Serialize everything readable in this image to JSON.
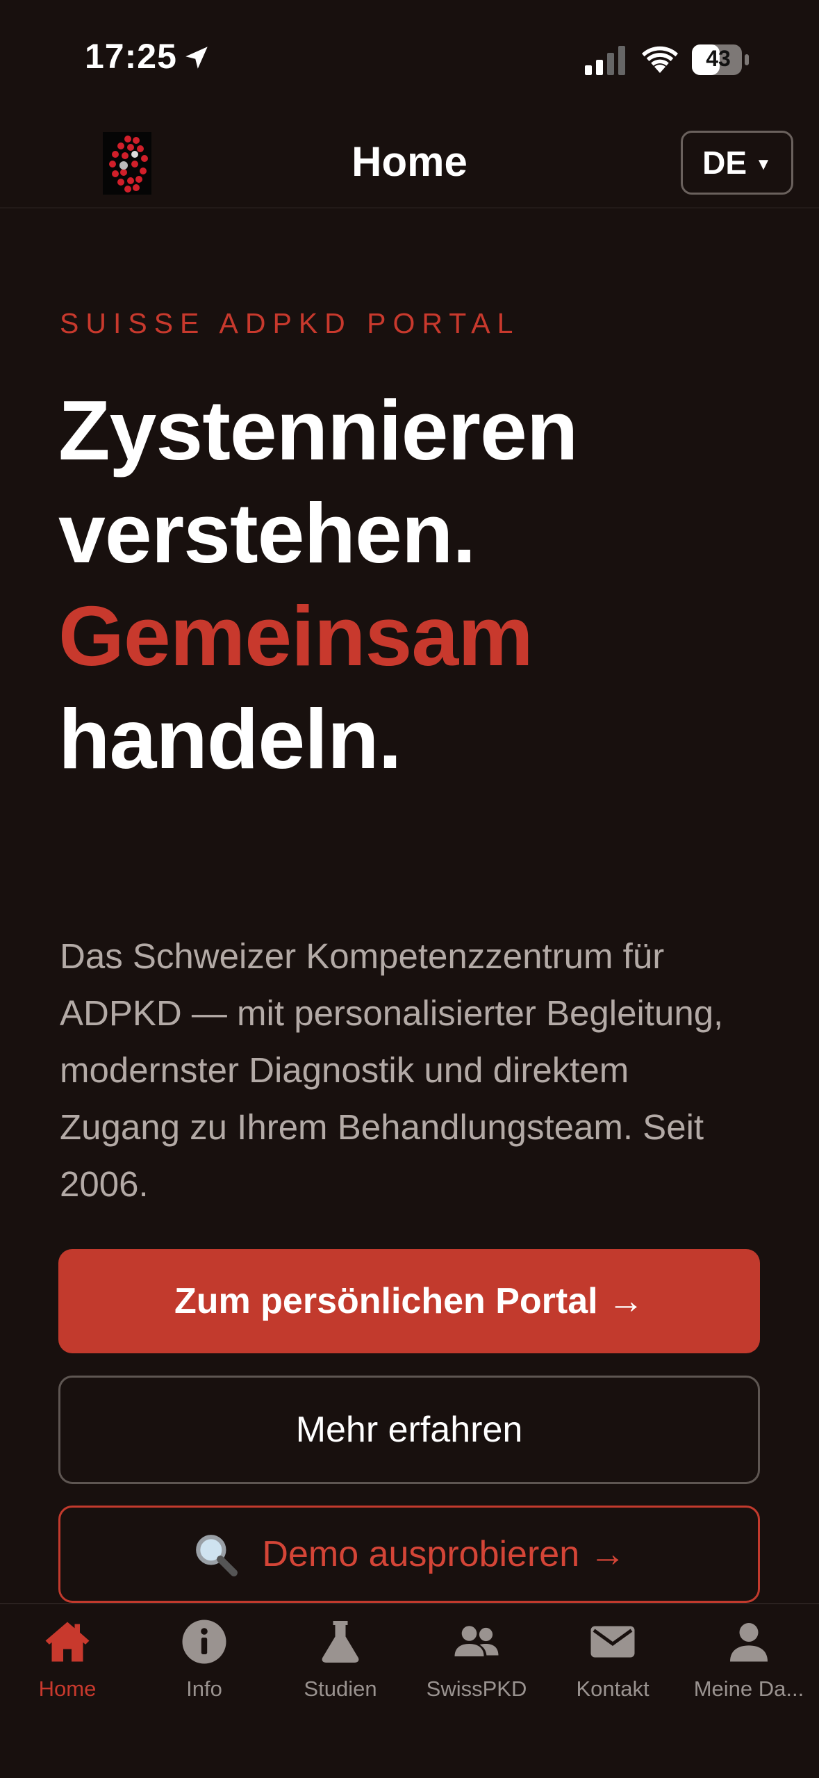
{
  "status_bar": {
    "time": "17:25",
    "battery": "43",
    "icons": [
      "location-arrow-icon",
      "signal-icon",
      "wifi-icon",
      "battery-icon"
    ]
  },
  "header": {
    "title": "Home",
    "language": "DE",
    "logo": "kidney-cells-logo"
  },
  "hero": {
    "eyebrow": "SUISSE ADPKD PORTAL",
    "line1": "Zystennieren",
    "line2": "verstehen.",
    "line3_accent": "Gemeinsam",
    "line4": "handeln.",
    "description": "Das Schweizer Kompetenzzentrum für ADPKD — mit personalisierter Begleitung, modernster Diagnostik und direktem Zugang zu Ihrem Behandlungsteam. Seit 2006."
  },
  "actions": {
    "primary": "Zum persönlichen Portal →",
    "secondary": "Mehr erfahren",
    "demo": "Demo ausprobieren →",
    "demo_icon": "magnifier-icon"
  },
  "tabs": [
    {
      "label": "Home",
      "icon": "home-icon",
      "active": true
    },
    {
      "label": "Info",
      "icon": "info-icon",
      "active": false
    },
    {
      "label": "Studien",
      "icon": "flask-icon",
      "active": false
    },
    {
      "label": "SwissPKD",
      "icon": "people-icon",
      "active": false
    },
    {
      "label": "Kontakt",
      "icon": "envelope-icon",
      "active": false
    },
    {
      "label": "Meine Da...",
      "icon": "user-icon",
      "active": false
    }
  ],
  "colors": {
    "background": "#18100e",
    "accent": "#c23a2d",
    "text_muted": "#b3aaa6",
    "tab_inactive": "#9a9390"
  }
}
